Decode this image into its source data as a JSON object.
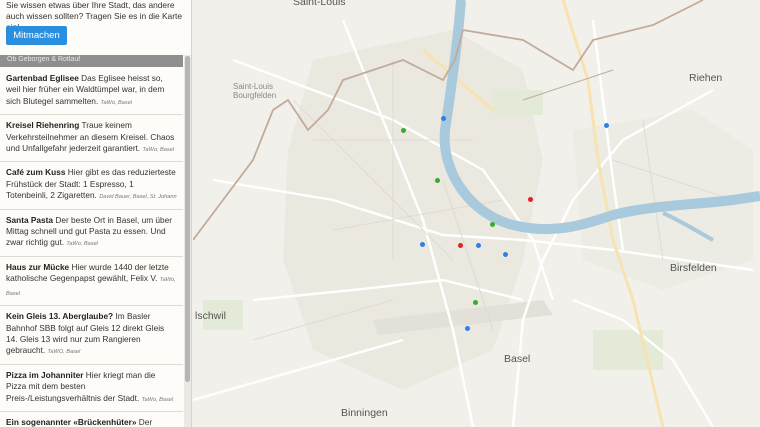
{
  "sidebar": {
    "intro": "Sie wissen etwas über Ihre Stadt, das andere auch wissen sollten? Tragen Sie es in die Karte ein!",
    "join_button": "Mitmachen",
    "section_label": "Ob Geborgen & Rotlauf",
    "entries": [
      {
        "title": "Gartenbad Eglisee",
        "text": "Das Eglisee heisst so, weil hier früher ein Waldtümpel war, in dem sich Blutegel sammelten.",
        "author": "TaWo, Basel"
      },
      {
        "title": "Kreisel Riehenring",
        "text": "Traue keinem Verkehrsteilnehmer an diesem Kreisel. Chaos und Unfallgefahr jederzeit garantiert.",
        "author": "TaWo, Basel"
      },
      {
        "title": "Café zum Kuss",
        "text": "Hier gibt es das reduzierteste Frühstück der Stadt: 1 Espresso, 1 Totenbeinli, 2 Zigaretten.",
        "author": "David Bauer, Basel, St. Johann"
      },
      {
        "title": "Santa Pasta",
        "text": "Der beste Ort in Basel, um über Mittag schnell und gut Pasta zu essen. Und zwar richtig gut.",
        "author": "TaWo, Basel"
      },
      {
        "title": "Haus zur Mücke",
        "text": "Hier wurde 1440 der letzte katholische Gegenpapst gewählt, Felix V.",
        "author": "TaWo, Basel"
      },
      {
        "title": "Kein Gleis 13. Aberglaube?",
        "text": "Im Basler Bahnhof SBB folgt auf Gleis 12 direkt Gleis 14. Gleis 13 wird nur zum Rangieren gebraucht.",
        "author": "TaWO, Basel"
      },
      {
        "title": "Pizza im Johanniter",
        "text": "Hier kriegt man die Pizza mit dem besten Preis-/Leistungsverhältnis der Stadt.",
        "author": "TaWo, Basel"
      },
      {
        "title": "Ein sogenannter «Brückenhüter»",
        "text": "Der Basilisk am oberen Ende der Wettsteinbrücke",
        "author": ""
      }
    ]
  },
  "map": {
    "places": {
      "saint_louis": "Saint-Louis",
      "riehen": "Riehen",
      "birsfelden": "Birsfelden",
      "basel": "Basel",
      "binningen": "Binningen",
      "schwil": "lschwil",
      "saint_louis_bourgfelden": "Saint-Louis Bourgfelden"
    },
    "marker_colors": {
      "blue": "#2f7fe8",
      "green": "#3aa832",
      "red": "#e02424"
    }
  }
}
